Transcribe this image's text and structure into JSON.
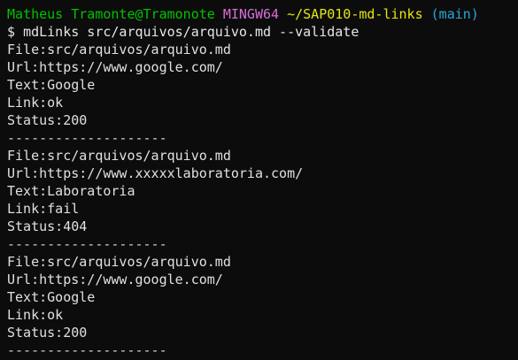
{
  "prompt": {
    "user_host": "Matheus Tramonte@Tramonote",
    "system": "MINGW64",
    "path": "~/SAP010-md-links",
    "branch": "(main)",
    "symbol": "$",
    "command": "mdLinks src/arquivos/arquivo.md --validate"
  },
  "results": [
    {
      "file": "File:src/arquivos/arquivo.md",
      "url": "Url:https://www.google.com/",
      "text": "Text:Google",
      "link": "Link:ok",
      "status": "Status:200",
      "separator": "--------------------"
    },
    {
      "file": "File:src/arquivos/arquivo.md",
      "url": "Url:https://www.xxxxxlaboratoria.com/",
      "text": "Text:Laboratoria",
      "link": "Link:fail",
      "status": "Status:404",
      "separator": "--------------------"
    },
    {
      "file": "File:src/arquivos/arquivo.md",
      "url": "Url:https://www.google.com/",
      "text": "Text:Google",
      "link": "Link:ok",
      "status": "Status:200",
      "separator": "--------------------"
    }
  ],
  "colors": {
    "background": "#0c0c0c",
    "user_host": "#00c300",
    "system": "#d86ed8",
    "path": "#e5e510",
    "branch": "#2aa8d8",
    "text": "#e0e0e0"
  }
}
